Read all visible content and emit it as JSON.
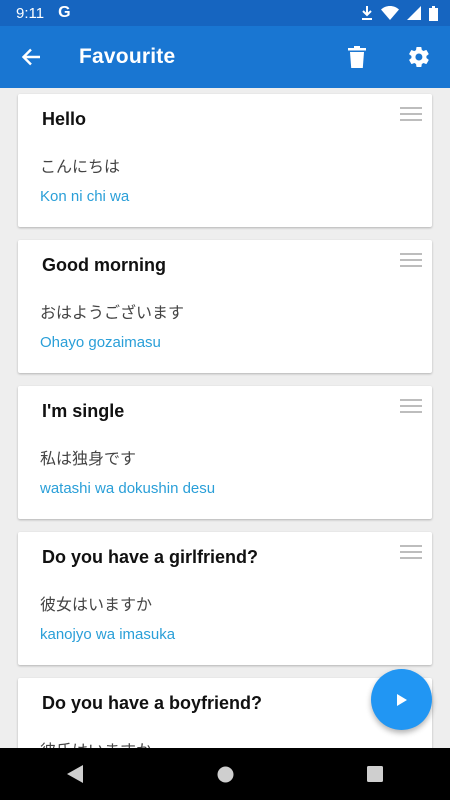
{
  "status": {
    "time": "9:11",
    "app_icon": "G"
  },
  "header": {
    "title": "Favourite"
  },
  "cards": [
    {
      "english": "Hello",
      "japanese": "こんにちは",
      "romaji": "Kon ni chi wa"
    },
    {
      "english": "Good morning",
      "japanese": "おはようございます",
      "romaji": "Ohayo gozaimasu"
    },
    {
      "english": "I'm single",
      "japanese": "私は独身です",
      "romaji": "watashi wa dokushin desu"
    },
    {
      "english": "Do you have a girlfriend?",
      "japanese": "彼女はいますか",
      "romaji": "kanojyo wa imasuka"
    },
    {
      "english": "Do you have a boyfriend?",
      "japanese": "彼氏はいますか",
      "romaji": ""
    }
  ],
  "icons": {
    "back": "arrow-back-icon",
    "delete": "trash-icon",
    "settings": "gear-icon",
    "drag": "drag-handle-icon",
    "play": "play-icon"
  },
  "colors": {
    "app_bar": "#1976d2",
    "status_bar": "#1665c0",
    "romaji": "#2a9fd8",
    "fab": "#2196f3"
  }
}
